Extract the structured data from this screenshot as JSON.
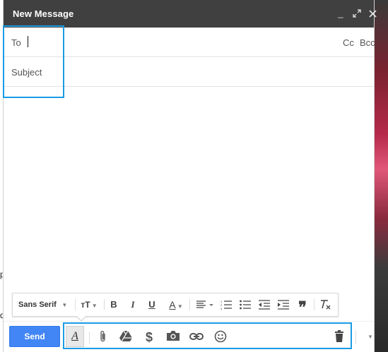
{
  "window": {
    "title": "New Message",
    "controls": {
      "minimize": "_",
      "popout": "⤢",
      "close": "✕"
    }
  },
  "recipients": {
    "to_label": "To",
    "to_value": "",
    "cc_label": "Cc",
    "bcc_label": "Bcc"
  },
  "subject": {
    "placeholder": "Subject",
    "value": ""
  },
  "message_body": {
    "value": ""
  },
  "format_toolbar": {
    "font_family": "Sans Serif",
    "font_size_icon": "ᴛT",
    "bold": "B",
    "italic": "I",
    "underline": "U",
    "text_color_icon": "A",
    "align_icon": "align-icon",
    "numbered_list_icon": "numbered-list-icon",
    "bulleted_list_icon": "bulleted-list-icon",
    "indent_less_icon": "indent-less-icon",
    "indent_more_icon": "indent-more-icon",
    "quote_icon": "quote-icon",
    "remove_formatting_icon": "remove-formatting-icon"
  },
  "bottom_toolbar": {
    "send_label": "Send",
    "formatting_toggle_label": "A",
    "icons": [
      "attach-icon",
      "drive-icon",
      "dollar-icon",
      "camera-icon",
      "link-icon",
      "emoji-icon",
      "trash-icon",
      "more-options-icon"
    ]
  },
  "background_text": {
    "line1": "p",
    "line2": "d"
  },
  "colors": {
    "titlebar": "#404040",
    "send_button": "#4285f4",
    "highlight": "#1a9be6"
  }
}
